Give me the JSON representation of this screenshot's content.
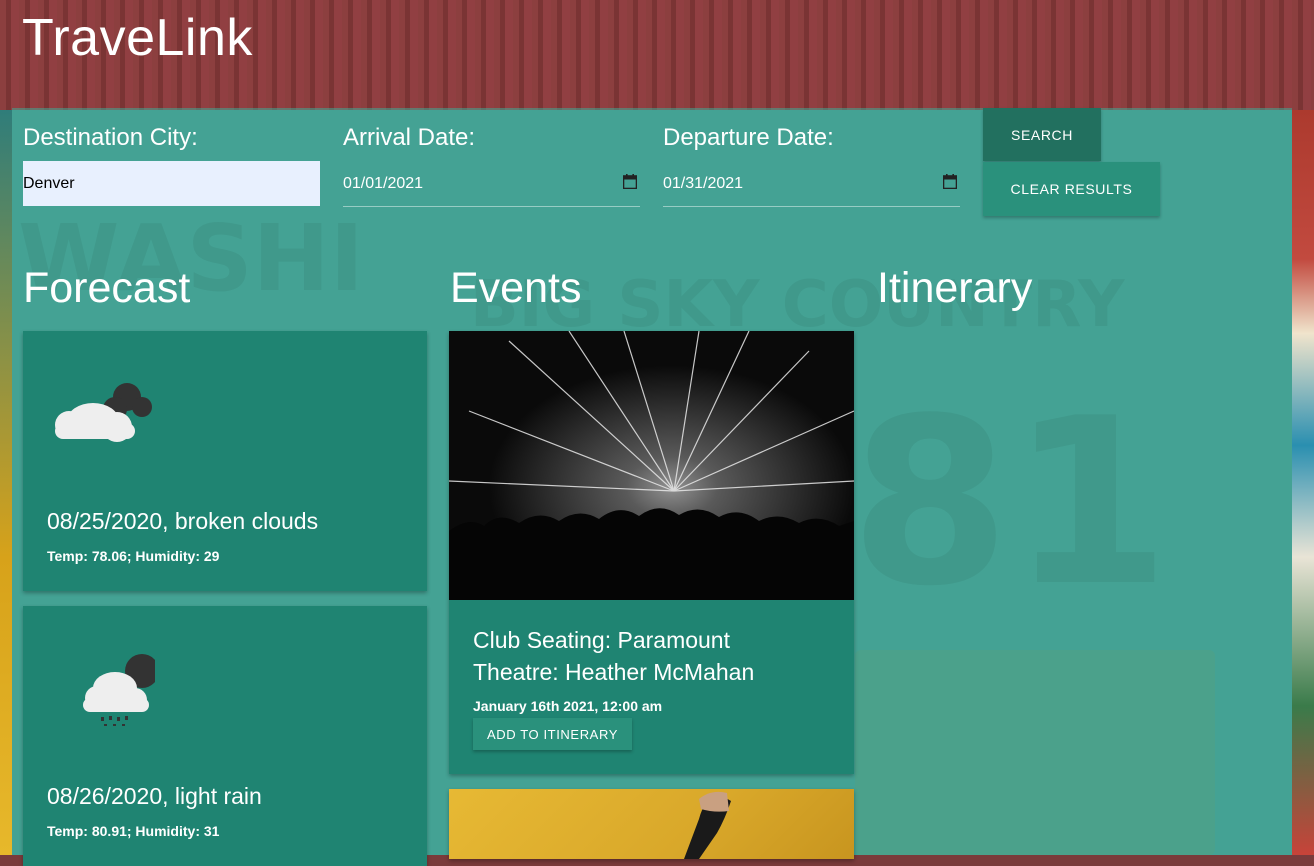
{
  "app": {
    "title": "TraveLink"
  },
  "search": {
    "destination_label": "Destination City:",
    "destination_value": "Denver",
    "arrival_label": "Arrival Date:",
    "arrival_value": "01/01/2021",
    "departure_label": "Departure Date:",
    "departure_value": "01/31/2021",
    "search_button": "SEARCH",
    "clear_button": "CLEAR RESULTS"
  },
  "forecast": {
    "heading": "Forecast",
    "items": [
      {
        "icon": "broken-clouds-icon",
        "title": "08/25/2020, broken clouds",
        "details": "Temp: 78.06; Humidity: 29"
      },
      {
        "icon": "light-rain-icon",
        "title": "08/26/2020, light rain",
        "details": "Temp: 80.91; Humidity: 31"
      }
    ]
  },
  "events": {
    "heading": "Events",
    "items": [
      {
        "image": "concert-photo",
        "title": "Club Seating: Paramount Theatre: Heather McMahan",
        "date": "January 16th 2021, 12:00 am",
        "button": "ADD TO ITINERARY"
      },
      {
        "image": "gold-event-photo"
      }
    ]
  },
  "itinerary": {
    "heading": "Itinerary"
  },
  "colors": {
    "card": "#1f8472",
    "panel": "#40aa96",
    "button_dark": "#22705f",
    "button": "#2a917c"
  }
}
